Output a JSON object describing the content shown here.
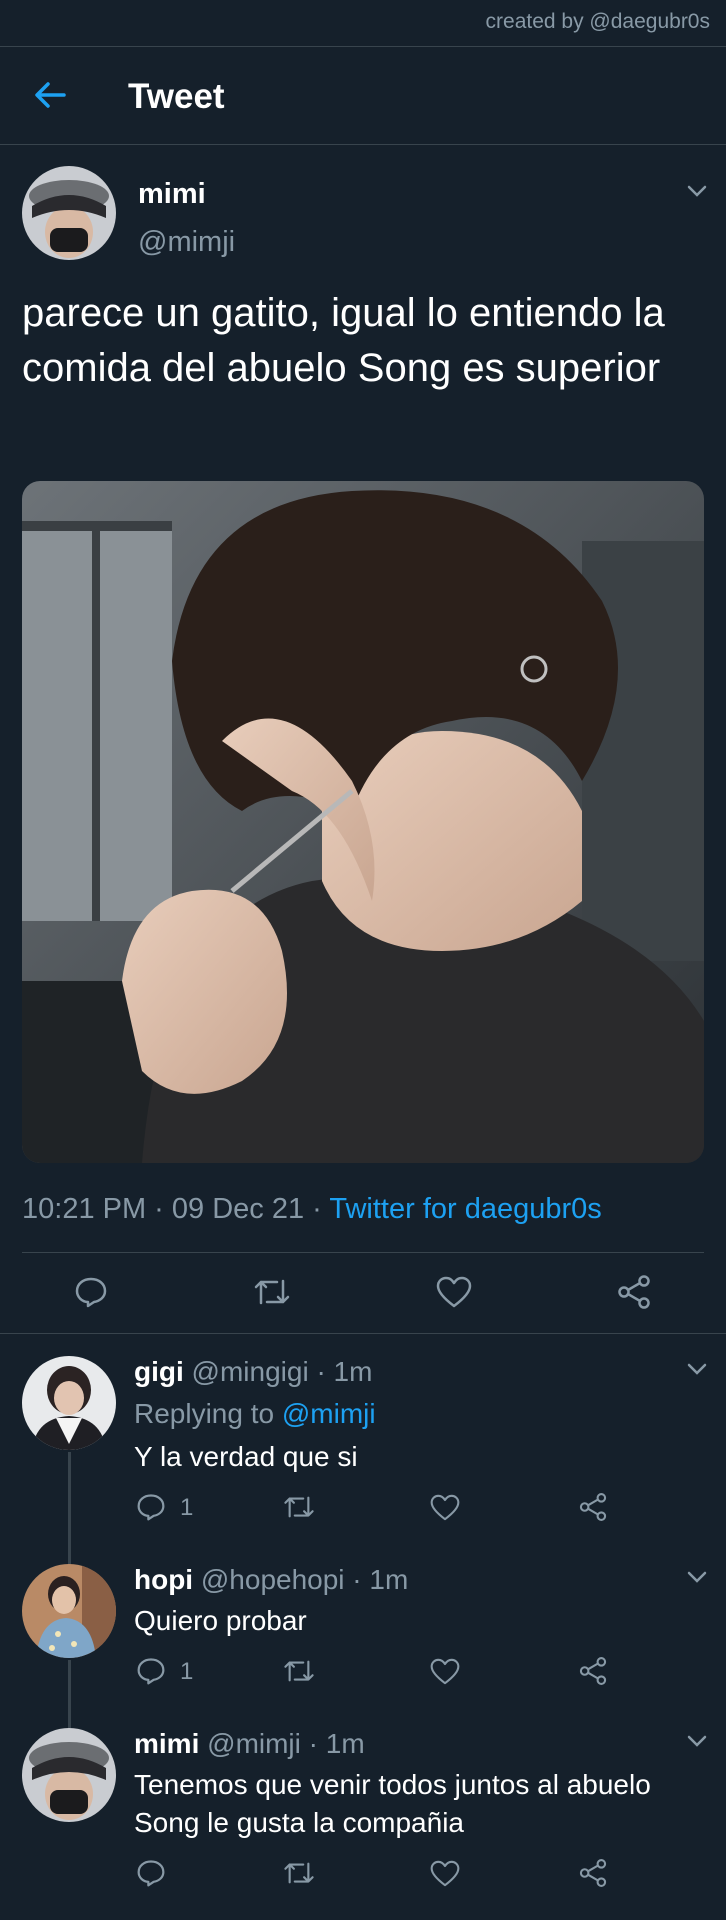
{
  "credit": "created by @daegubr0s",
  "header": {
    "title": "Tweet",
    "back_icon": "arrow-left-icon"
  },
  "main_tweet": {
    "name": "mimi",
    "handle": "@mimji",
    "text": "parece un gatito, igual lo entiendo la comida del abuelo Song es superior",
    "time": "10:21 PM · 09 Dec 21 · ",
    "source": "Twitter for daegubr0s"
  },
  "replies": [
    {
      "name": "gigi",
      "handle": "@mingigi · 1m",
      "replying_prefix": "Replying to ",
      "replying_to": "@mimji",
      "text": "Y la verdad que si",
      "reply_count": "1"
    },
    {
      "name": "hopi",
      "handle": "@hopehopi · 1m",
      "text": "Quiero probar",
      "reply_count": "1"
    },
    {
      "name": "mimi",
      "handle": "@mimji · 1m",
      "text": "Tenemos que venir todos juntos al abuelo Song le gusta la compañia",
      "reply_count": ""
    }
  ],
  "colors": {
    "background": "#15202b",
    "accent": "#1da1f2",
    "muted": "#8899a6",
    "divider": "#38444d"
  }
}
